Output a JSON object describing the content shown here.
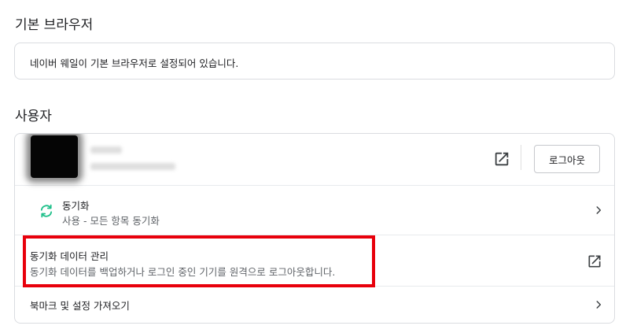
{
  "default_browser": {
    "title": "기본 브라우저",
    "message": "네이버 웨일이 기본 브라우저로 설정되어 있습니다."
  },
  "user": {
    "title": "사용자",
    "logout_label": "로그아웃",
    "sync": {
      "title": "동기화",
      "subtitle": "사용 - 모든 항목 동기화"
    },
    "manage": {
      "title": "동기화 데이터 관리",
      "subtitle": "동기화 데이터를 백업하거나 로그인 중인 기기를 원격으로 로그아웃합니다."
    },
    "import": {
      "title": "북마크 및 설정 가져오기"
    }
  },
  "colors": {
    "accent_green": "#1fc08a",
    "highlight_red": "#e8000b",
    "border": "#dadce0"
  },
  "icons": [
    "external-link-icon",
    "sync-icon",
    "chevron-right-icon"
  ]
}
